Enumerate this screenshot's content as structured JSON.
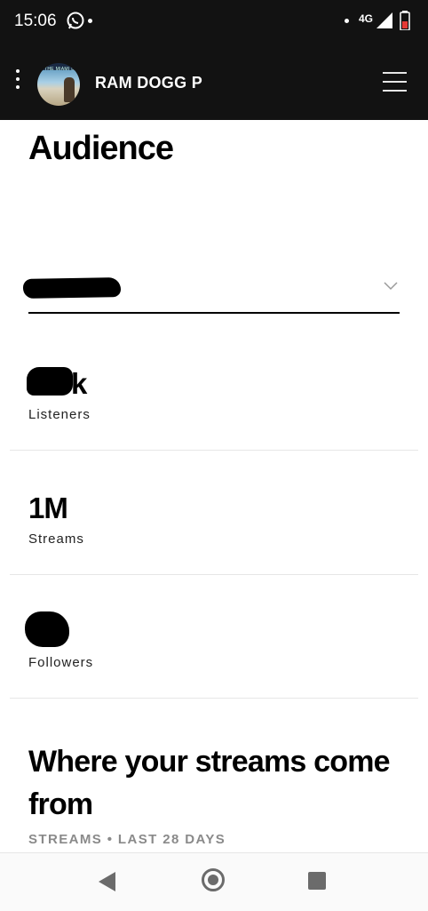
{
  "status_bar": {
    "time": "15:06",
    "network": "4G",
    "icons": [
      "whatsapp-icon",
      "signal-icon",
      "battery-icon"
    ]
  },
  "header": {
    "artist_name": "RAM DOGG P",
    "icons": [
      "more-vertical-icon",
      "menu-icon"
    ]
  },
  "page": {
    "title": "Audience"
  },
  "filter": {
    "selected_value": "",
    "icon": "chevron-down-icon"
  },
  "metrics": [
    {
      "value": "k",
      "label": "Listeners"
    },
    {
      "value": "1M",
      "label": "Streams"
    },
    {
      "value": "",
      "label": "Followers"
    }
  ],
  "section": {
    "title": "Where your streams come from",
    "subtitle": "STREAMS • LAST 28 DAYS"
  },
  "colors": {
    "header_bg": "#121212",
    "accent_text": "#000000",
    "muted_text": "#8a8a8a"
  }
}
